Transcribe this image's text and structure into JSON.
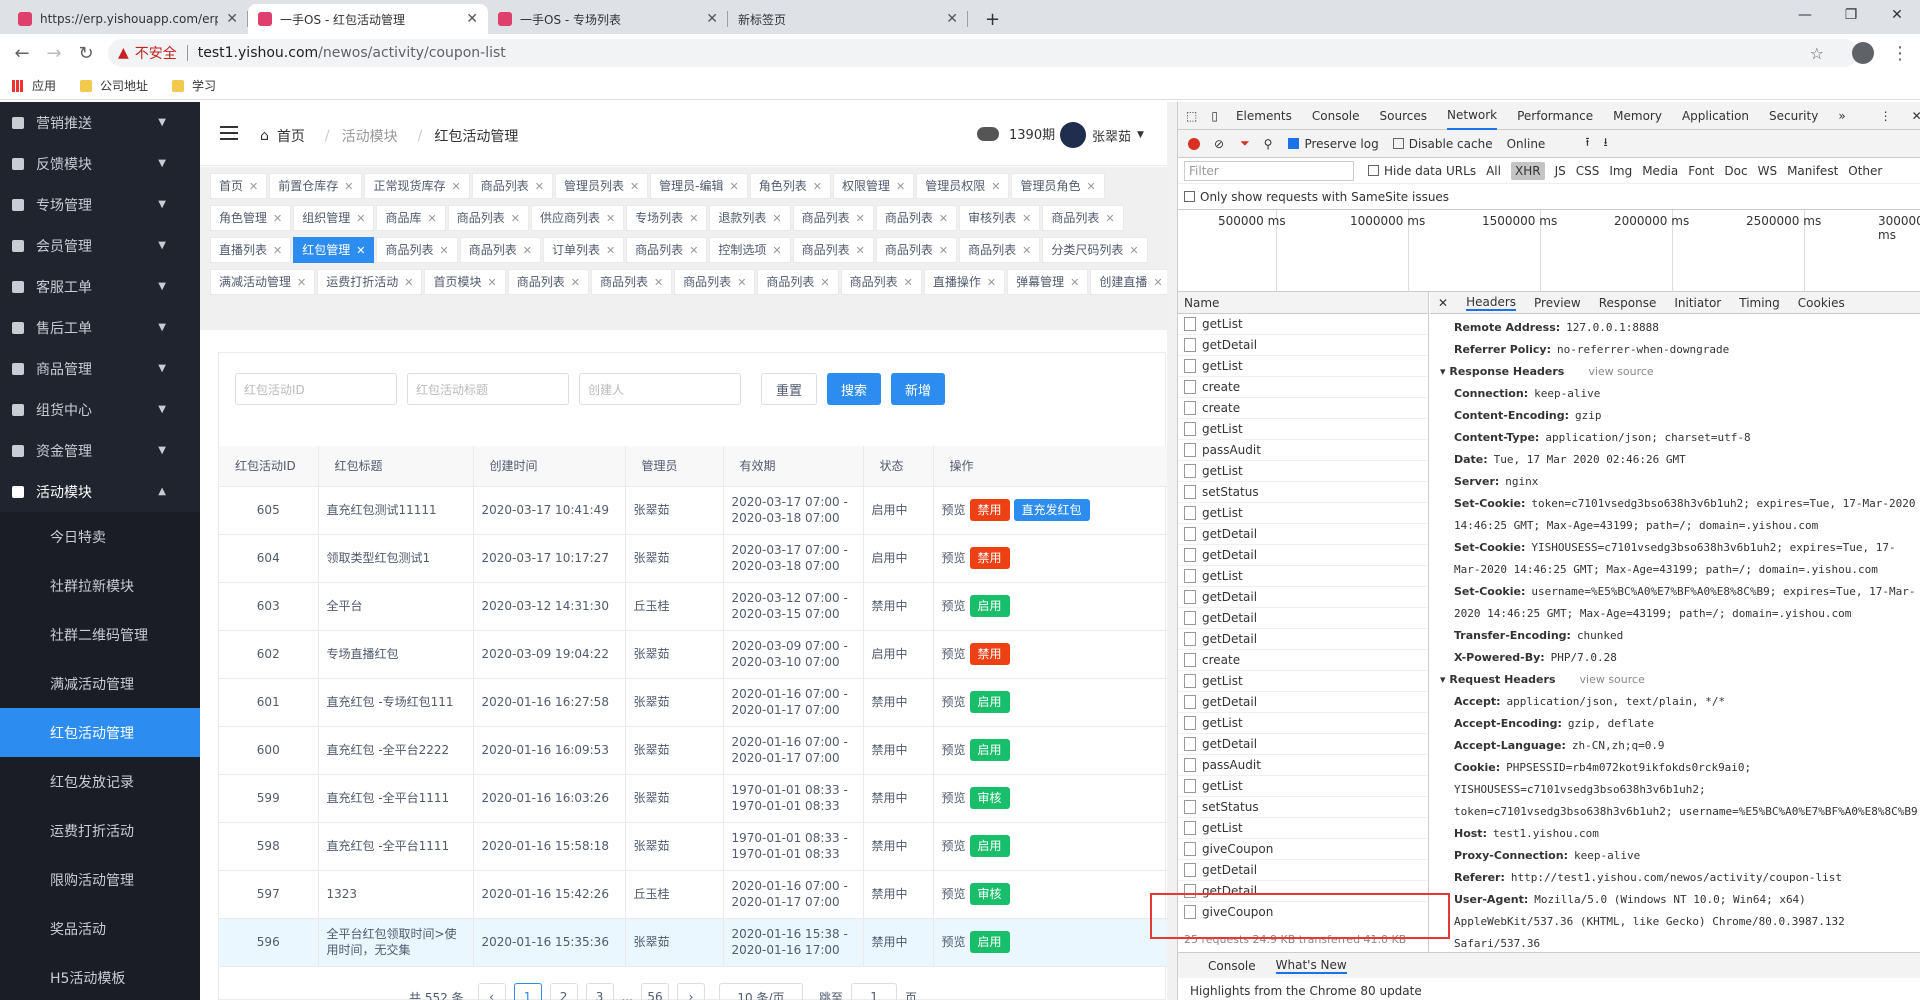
{
  "browser": {
    "tabs": [
      {
        "title": "https://erp.yishouapp.com/erp",
        "active": false
      },
      {
        "title": "一手OS - 红包活动管理",
        "active": true
      },
      {
        "title": "一手OS - 专场列表",
        "active": false
      },
      {
        "title": "新标签页",
        "active": false
      }
    ],
    "new_tab": "+",
    "insecure_label": "不安全",
    "url_host": "test1.yishou.com",
    "url_path": "/newos/activity/coupon-list",
    "bookmarks": [
      "应用",
      "公司地址",
      "学习"
    ]
  },
  "sidebar": {
    "items": [
      "营销推送",
      "反馈模块",
      "专场管理",
      "会员管理",
      "客服工单",
      "售后工单",
      "商品管理",
      "组货中心",
      "资金管理",
      "活动模块"
    ],
    "subitems": [
      "今日特卖",
      "社群拉新模块",
      "社群二维码管理",
      "满减活动管理",
      "红包活动管理",
      "红包发放记录",
      "运费打折活动",
      "限购活动管理",
      "奖品活动",
      "H5活动模板"
    ]
  },
  "header": {
    "crumbs": [
      "首页",
      "活动模块",
      "红包活动管理"
    ],
    "period": "1390期",
    "user": "张翠茹"
  },
  "tags": [
    "首页",
    "前置仓库存",
    "正常现货库存",
    "商品列表",
    "管理员列表",
    "管理员-编辑",
    "角色列表",
    "权限管理",
    "管理员权限",
    "管理员角色",
    "角色管理",
    "组织管理",
    "商品库",
    "商品列表",
    "供应商列表",
    "专场列表",
    "退款列表",
    "商品列表",
    "商品列表",
    "审核列表",
    "商品列表",
    "直播列表",
    "红包管理",
    "商品列表",
    "商品列表",
    "订单列表",
    "商品列表",
    "控制选项",
    "商品列表",
    "商品列表",
    "商品列表",
    "分类尺码列表",
    "满减活动管理",
    "运费打折活动",
    "首页模块",
    "商品列表",
    "商品列表",
    "商品列表",
    "商品列表",
    "商品列表",
    "直播操作",
    "弹幕管理",
    "创建直播"
  ],
  "active_tag_index": 22,
  "filters": {
    "id_placeholder": "红包活动ID",
    "title_placeholder": "红包活动标题",
    "creator_placeholder": "创建人",
    "reset": "重置",
    "search": "搜索",
    "add": "新增"
  },
  "table": {
    "columns": [
      "红包活动ID",
      "红包标题",
      "创建时间",
      "管理员",
      "有效期",
      "状态",
      "操作"
    ],
    "rows": [
      {
        "id": "605",
        "title": "直充红包测试11111",
        "created": "2020-03-17 10:41:49",
        "admin": "张翠茹",
        "valid": "2020-03-17 07:00 - 2020-03-18 07:00",
        "status": "启用中",
        "ops": [
          [
            "预览",
            ""
          ],
          [
            "禁用",
            "red"
          ],
          [
            "直充发红包",
            "blue"
          ]
        ]
      },
      {
        "id": "604",
        "title": "领取类型红包测试1",
        "created": "2020-03-17 10:17:27",
        "admin": "张翠茹",
        "valid": "2020-03-17 07:00 - 2020-03-18 07:00",
        "status": "启用中",
        "ops": [
          [
            "预览",
            ""
          ],
          [
            "禁用",
            "red"
          ]
        ]
      },
      {
        "id": "603",
        "title": "全平台",
        "created": "2020-03-12 14:31:30",
        "admin": "丘玉桂",
        "valid": "2020-03-12 07:00 - 2020-03-15 07:00",
        "status": "禁用中",
        "ops": [
          [
            "预览",
            ""
          ],
          [
            "启用",
            "green"
          ]
        ]
      },
      {
        "id": "602",
        "title": "专场直播红包",
        "created": "2020-03-09 19:04:22",
        "admin": "张翠茹",
        "valid": "2020-03-09 07:00 - 2020-03-10 07:00",
        "status": "启用中",
        "ops": [
          [
            "预览",
            ""
          ],
          [
            "禁用",
            "red"
          ]
        ]
      },
      {
        "id": "601",
        "title": "直充红包 -专场红包111",
        "created": "2020-01-16 16:27:58",
        "admin": "张翠茹",
        "valid": "2020-01-16 07:00 - 2020-01-17 07:00",
        "status": "禁用中",
        "ops": [
          [
            "预览",
            ""
          ],
          [
            "启用",
            "green"
          ]
        ]
      },
      {
        "id": "600",
        "title": "直充红包 -全平台2222",
        "created": "2020-01-16 16:09:53",
        "admin": "张翠茹",
        "valid": "2020-01-16 07:00 - 2020-01-17 07:00",
        "status": "禁用中",
        "ops": [
          [
            "预览",
            ""
          ],
          [
            "启用",
            "green"
          ]
        ]
      },
      {
        "id": "599",
        "title": "直充红包 -全平台1111",
        "created": "2020-01-16 16:03:26",
        "admin": "张翠茹",
        "valid": "1970-01-01 08:33 - 1970-01-01 08:33",
        "status": "禁用中",
        "ops": [
          [
            "预览",
            ""
          ],
          [
            "审核",
            "green"
          ]
        ]
      },
      {
        "id": "598",
        "title": "直充红包 -全平台1111",
        "created": "2020-01-16 15:58:18",
        "admin": "张翠茹",
        "valid": "1970-01-01 08:33 - 1970-01-01 08:33",
        "status": "禁用中",
        "ops": [
          [
            "预览",
            ""
          ],
          [
            "启用",
            "green"
          ]
        ]
      },
      {
        "id": "597",
        "title": "1323",
        "created": "2020-01-16 15:42:26",
        "admin": "丘玉桂",
        "valid": "2020-01-16 07:00 - 2020-01-17 07:00",
        "status": "禁用中",
        "ops": [
          [
            "预览",
            ""
          ],
          [
            "审核",
            "green"
          ]
        ]
      },
      {
        "id": "596",
        "title": "全平台红包领取时间>使用时间，无交集",
        "created": "2020-01-16 15:35:36",
        "admin": "张翠茹",
        "valid": "2020-01-16 15:38 - 2020-01-16 17:00",
        "status": "禁用中",
        "ops": [
          [
            "预览",
            ""
          ],
          [
            "启用",
            "green"
          ]
        ]
      }
    ]
  },
  "pager": {
    "total": "共 552 条",
    "pages": [
      "1",
      "2",
      "3",
      "...",
      "56"
    ],
    "per_page": "10 条/页",
    "goto": "跳至",
    "page_unit": "页",
    "goto_value": "1"
  },
  "devtools": {
    "tabs": [
      "Elements",
      "Console",
      "Sources",
      "Network",
      "Performance",
      "Memory",
      "Application",
      "Security"
    ],
    "preserve_log": "Preserve log",
    "disable_cache": "Disable cache",
    "throttle": "Online",
    "filter_placeholder": "Filter",
    "hide_data_urls": "Hide data URLs",
    "types": [
      "All",
      "XHR",
      "JS",
      "CSS",
      "Img",
      "Media",
      "Font",
      "Doc",
      "WS",
      "Manifest",
      "Other"
    ],
    "samesite": "Only show requests with SameSite issues",
    "timeline_labels": [
      "500000 ms",
      "1000000 ms",
      "1500000 ms",
      "2000000 ms",
      "2500000 ms",
      "3000000 ms"
    ],
    "name_header": "Name",
    "requests": [
      "getList",
      "getDetail",
      "getList",
      "create",
      "create",
      "getList",
      "passAudit",
      "getList",
      "setStatus",
      "getList",
      "getDetail",
      "getDetail",
      "getList",
      "getDetail",
      "getDetail",
      "getDetail",
      "create",
      "getList",
      "getDetail",
      "getList",
      "getDetail",
      "passAudit",
      "getList",
      "setStatus",
      "getList",
      "giveCoupon",
      "getDetail",
      "getDetail",
      "giveCoupon"
    ],
    "summary": "25 requests   24.9 KB transferred   41.0 KB",
    "detail_tabs": [
      "Headers",
      "Preview",
      "Response",
      "Initiator",
      "Timing",
      "Cookies"
    ],
    "general": [
      [
        "Remote Address:",
        "127.0.0.1:8888"
      ],
      [
        "Referrer Policy:",
        "no-referrer-when-downgrade"
      ]
    ],
    "response_headers_title": "Response Headers",
    "request_headers_title": "Request Headers",
    "view_source": "view source",
    "response_headers": [
      [
        "Connection:",
        "keep-alive"
      ],
      [
        "Content-Encoding:",
        "gzip"
      ],
      [
        "Content-Type:",
        "application/json; charset=utf-8"
      ],
      [
        "Date:",
        "Tue, 17 Mar 2020 02:46:26 GMT"
      ],
      [
        "Server:",
        "nginx"
      ],
      [
        "Set-Cookie:",
        "token=c7101vsedg3bso638h3v6b1uh2; expires=Tue, 17-Mar-2020 14:46:25 GMT; Max-Age=43199; path=/; domain=.yishou.com"
      ],
      [
        "Set-Cookie:",
        "YISHOUSESS=c7101vsedg3bso638h3v6b1uh2; expires=Tue, 17-Mar-2020 14:46:25 GMT; Max-Age=43199; path=/; domain=.yishou.com"
      ],
      [
        "Set-Cookie:",
        "username=%E5%BC%A0%E7%BF%A0%E8%8C%B9; expires=Tue, 17-Mar-2020 14:46:25 GMT; Max-Age=43199; path=/; domain=.yishou.com"
      ],
      [
        "Transfer-Encoding:",
        "chunked"
      ],
      [
        "X-Powered-By:",
        "PHP/7.0.28"
      ]
    ],
    "request_headers": [
      [
        "Accept:",
        "application/json, text/plain, */*"
      ],
      [
        "Accept-Encoding:",
        "gzip, deflate"
      ],
      [
        "Accept-Language:",
        "zh-CN,zh;q=0.9"
      ],
      [
        "Cookie:",
        "PHPSESSID=rb4m072kot9ikfokds0rck9ai0; YISHOUSESS=c7101vsedg3bso638h3v6b1uh2; token=c7101vsedg3bso638h3v6b1uh2; username=%E5%BC%A0%E7%BF%A0%E8%8C%B9"
      ],
      [
        "Host:",
        "test1.yishou.com"
      ],
      [
        "Proxy-Connection:",
        "keep-alive"
      ],
      [
        "Referer:",
        "http://test1.yishou.com/newos/activity/coupon-list"
      ],
      [
        "User-Agent:",
        "Mozilla/5.0 (Windows NT 10.0; Win64; x64) AppleWebKit/537.36 (KHTML, like Gecko) Chrome/80.0.3987.132 Safari/537.36"
      ]
    ],
    "drawer_tabs": [
      "Console",
      "What's New"
    ],
    "drawer_msg": "Highlights from the Chrome 80 update"
  }
}
